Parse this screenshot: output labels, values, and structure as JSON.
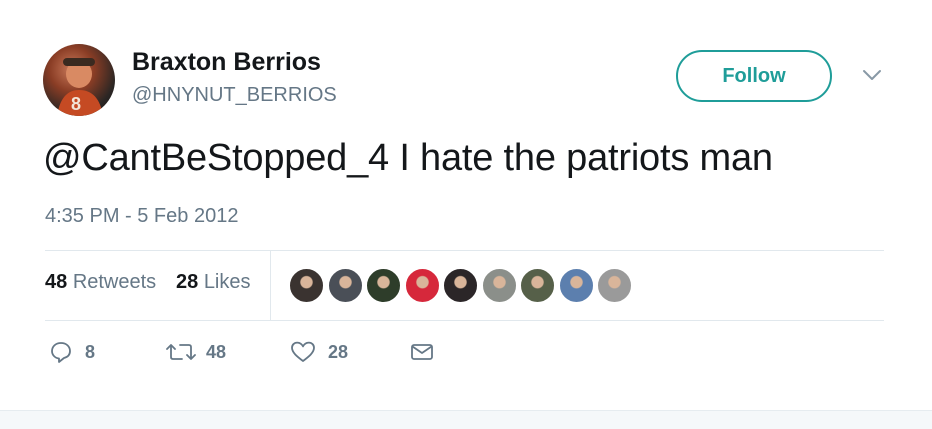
{
  "author": {
    "name": "Braxton Berrios",
    "handle": "@HNYNUT_BERRIOS",
    "avatar_icon": "profile-photo-icon"
  },
  "follow_button": {
    "label": "Follow",
    "color": "#1f9d99"
  },
  "tweet": {
    "text": "@CantBeStopped_4 I hate the patriots man",
    "timestamp": "4:35 PM - 5 Feb 2012"
  },
  "stats": {
    "retweets": {
      "count": "48",
      "label": "Retweets"
    },
    "likes": {
      "count": "28",
      "label": "Likes"
    }
  },
  "likers": [
    {
      "icon": "liker-avatar-icon",
      "color": "#3a3330"
    },
    {
      "icon": "liker-avatar-icon",
      "color": "#4a4f57"
    },
    {
      "icon": "liker-avatar-icon",
      "color": "#2e3d2a"
    },
    {
      "icon": "liker-avatar-icon",
      "color": "#d6283b"
    },
    {
      "icon": "liker-avatar-icon",
      "color": "#2b2628"
    },
    {
      "icon": "liker-avatar-icon",
      "color": "#8b8f8a"
    },
    {
      "icon": "liker-avatar-icon",
      "color": "#566049"
    },
    {
      "icon": "liker-avatar-icon",
      "color": "#5c7fae"
    },
    {
      "icon": "liker-avatar-icon",
      "color": "#9a9a9a"
    }
  ],
  "actions": {
    "reply": {
      "icon": "reply-icon",
      "count": "8"
    },
    "retweet": {
      "icon": "retweet-icon",
      "count": "48"
    },
    "like": {
      "icon": "heart-icon",
      "count": "28"
    },
    "message": {
      "icon": "envelope-icon"
    }
  }
}
